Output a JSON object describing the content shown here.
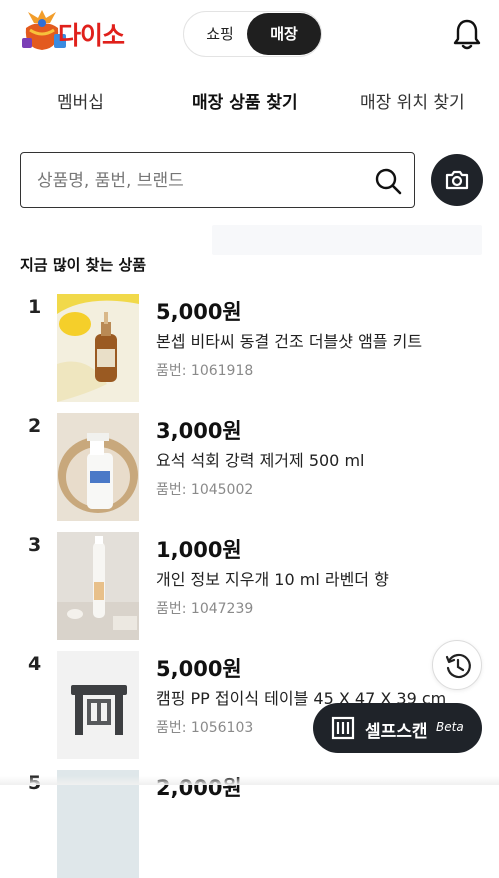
{
  "header": {
    "logo_text": "다이소",
    "segment": {
      "shopping": "쇼핑",
      "store": "매장"
    }
  },
  "tabs": [
    {
      "label": "멤버십"
    },
    {
      "label": "매장 상품 찾기"
    },
    {
      "label": "매장 위치 찾기"
    }
  ],
  "search": {
    "placeholder": "상품명, 품번, 브랜드"
  },
  "section_title": "지금 많이 찾는 상품",
  "products": [
    {
      "rank": "1",
      "price": "5,000원",
      "name": "본셉 비타씨 동결 건조 더블샷 앰플 키트",
      "code": "품번: 1061918"
    },
    {
      "rank": "2",
      "price": "3,000원",
      "name": "요석 석회 강력 제거제 500 ml",
      "code": "품번: 1045002"
    },
    {
      "rank": "3",
      "price": "1,000원",
      "name": "개인 정보 지우개 10 ml 라벤더 향",
      "code": "품번: 1047239"
    },
    {
      "rank": "4",
      "price": "5,000원",
      "name": "캠핑 PP 접이식 테이블 45 X 47 X 39 cm",
      "code": "품번: 1056103"
    },
    {
      "rank": "5",
      "price": "2,000원",
      "name": "",
      "code": ""
    }
  ],
  "selfscan": {
    "label": "셀프스캔",
    "beta": "Beta"
  },
  "colors": {
    "brand_red": "#e0201b",
    "dark": "#1f2329"
  }
}
